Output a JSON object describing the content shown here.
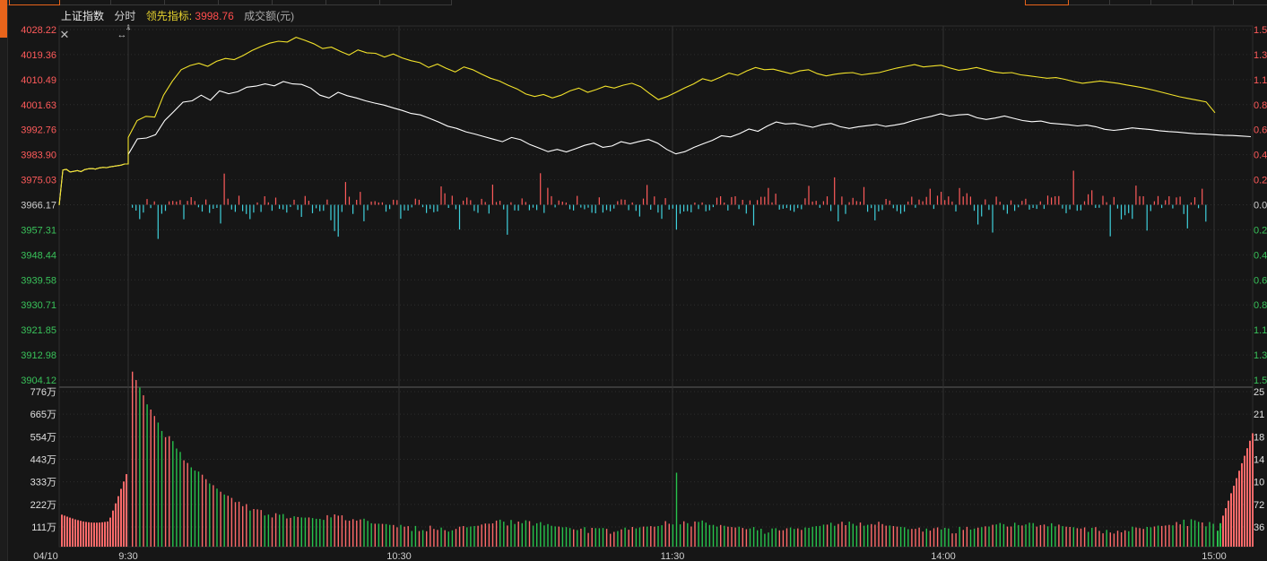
{
  "header": {
    "index_name": "上证指数",
    "mode": "分时",
    "lead_label": "领先指标:",
    "lead_value": "3998.76",
    "amount_label": "成交额(元)"
  },
  "colors": {
    "background": "#161616",
    "grid": "#2e2e2e",
    "index_line": "#ffffff",
    "lead_line": "#f2e22a",
    "up": "#ff5a5a",
    "down": "#3fd0dc",
    "vol_up": "#ff6a6a",
    "vol_down": "#27c24c",
    "price_up_label": "#ff5b5b",
    "price_down_label": "#39c25a",
    "neutral_label": "#cfcfcf"
  },
  "icons": {
    "close": "close-icon",
    "resize": "horizontal-resize-icon",
    "cursor": "vertical-cursor-icon"
  },
  "chart_data": {
    "type": "line",
    "x_ticks": [
      "04/10",
      "9:30",
      "10:30",
      "11:30",
      "14:00",
      "15:00"
    ],
    "price_axis": {
      "ticks": [
        "4028.22",
        "4019.36",
        "4010.49",
        "4001.63",
        "3992.76",
        "3983.90",
        "3975.03",
        "3966.17",
        "3957.31",
        "3948.44",
        "3939.58",
        "3930.71",
        "3921.85",
        "3912.98",
        "3904.12"
      ],
      "base": 3966.17,
      "ylim": [
        3904.12,
        4028.22
      ]
    },
    "pct_axis": {
      "ticks": [
        "1.5",
        "1.3",
        "1.1",
        "0.8",
        "0.6",
        "0.4",
        "0.2",
        "0.0",
        "0.2",
        "0.4",
        "0.6",
        "0.8",
        "1.1",
        "1.3",
        "1.5"
      ]
    },
    "volume_axis": {
      "left_ticks": [
        "776万",
        "665万",
        "554万",
        "443万",
        "333万",
        "222万",
        "111万"
      ],
      "right_ticks": [
        "25",
        "21",
        "18",
        "14",
        "10",
        "72",
        "36"
      ],
      "ylim": [
        0,
        776
      ]
    },
    "series": [
      {
        "name": "上证指数",
        "values": [
          3966.0,
          3978.5,
          3978.7,
          3977.8,
          3978.0,
          3978.3,
          3977.9,
          3978.6,
          3978.9,
          3979.0,
          3978.8,
          3979.2,
          3979.4,
          3979.3,
          3979.6,
          3979.8,
          3980.0,
          3980.2,
          3980.6,
          3980.6,
          3984.0,
          3989.5,
          3989.8,
          3991.0,
          3996.0,
          3999.2,
          4002.5,
          4003.0,
          4005.0,
          4003.2,
          4006.5,
          4005.5,
          4006.2,
          4007.8,
          4008.2,
          4009.0,
          4008.3,
          4009.8,
          4009.0,
          4008.8,
          4007.5,
          4005.0,
          4004.0,
          4006.0,
          4004.8,
          4004.0,
          4003.0,
          4002.2,
          4001.5,
          4000.5,
          3999.6,
          3998.5,
          3998.0,
          3996.8,
          3995.5,
          3994.0,
          3993.2,
          3992.0,
          3991.2,
          3990.3,
          3989.4,
          3988.5,
          3990.0,
          3989.2,
          3987.5,
          3986.3,
          3985.0,
          3985.8,
          3984.9,
          3986.0,
          3987.2,
          3988.0,
          3986.5,
          3987.0,
          3988.5,
          3987.8,
          3988.6,
          3989.3,
          3988.0,
          3985.8,
          3984.2,
          3985.0,
          3986.5,
          3987.8,
          3989.0,
          3990.6,
          3990.2,
          3991.4,
          3993.0,
          3992.2,
          3994.0,
          3995.5,
          3994.8,
          3995.0,
          3994.3,
          3993.6,
          3994.5,
          3995.0,
          3993.8,
          3993.2,
          3993.8,
          3994.2,
          3994.6,
          3993.9,
          3994.4,
          3995.0,
          3996.0,
          3996.8,
          3997.5,
          3998.4,
          3997.6,
          3998.0,
          3998.2,
          3997.0,
          3996.4,
          3996.9,
          3997.6,
          3996.8,
          3996.0,
          3995.6,
          3995.8,
          3995.1,
          3994.8,
          3994.5,
          3994.1,
          3994.4,
          3993.8,
          3992.9,
          3992.5,
          3992.9,
          3993.4,
          3993.1,
          3992.8,
          3992.4,
          3992.1,
          3991.9,
          3991.6,
          3991.3,
          3991.2,
          3991.0,
          3990.8,
          3990.7,
          3990.5,
          3990.3
        ],
        "x_start_min": 0,
        "x_end_min": 280
      },
      {
        "name": "领先指标",
        "values": [
          3966.0,
          3978.5,
          3978.7,
          3977.8,
          3978.0,
          3978.3,
          3977.9,
          3978.6,
          3978.9,
          3979.0,
          3978.8,
          3979.2,
          3979.4,
          3979.3,
          3979.6,
          3979.8,
          3980.0,
          3980.2,
          3980.6,
          3980.6,
          3990.0,
          3996.0,
          3997.5,
          3997.2,
          4005.0,
          4010.0,
          4014.0,
          4015.5,
          4016.3,
          4015.2,
          4017.0,
          4018.0,
          4017.6,
          4019.0,
          4020.8,
          4022.2,
          4023.4,
          4024.1,
          4023.8,
          4025.5,
          4024.4,
          4023.2,
          4021.5,
          4022.0,
          4020.5,
          4019.2,
          4021.0,
          4020.0,
          4019.8,
          4018.5,
          4019.6,
          4018.2,
          4017.2,
          4016.5,
          4014.8,
          4016.0,
          4014.5,
          4013.2,
          4015.0,
          4014.0,
          4012.4,
          4011.0,
          4010.0,
          4008.5,
          4007.2,
          4005.4,
          4004.5,
          4005.2,
          4004.0,
          4005.0,
          4006.5,
          4007.5,
          4006.0,
          4007.0,
          4008.2,
          4007.5,
          4008.5,
          4009.2,
          4008.0,
          4005.6,
          4003.4,
          4004.5,
          4006.0,
          4007.6,
          4009.0,
          4010.8,
          4010.0,
          4011.3,
          4012.8,
          4012.0,
          4013.6,
          4014.8,
          4014.0,
          4014.2,
          4013.4,
          4012.6,
          4013.6,
          4014.0,
          4012.6,
          4011.8,
          4012.4,
          4012.8,
          4013.0,
          4012.2,
          4012.6,
          4013.0,
          4013.8,
          4014.6,
          4015.2,
          4015.8,
          4015.0,
          4015.3,
          4015.6,
          4014.6,
          4013.8,
          4014.2,
          4014.8,
          4014.0,
          4013.2,
          4012.8,
          4013.0,
          4012.2,
          4011.8,
          4011.4,
          4011.0,
          4011.2,
          4010.6,
          4009.8,
          4009.2,
          4009.6,
          4010.0,
          4009.6,
          4009.2,
          4008.6,
          4008.1,
          4007.5,
          4006.8,
          4006.0,
          4005.2,
          4004.4,
          4003.8,
          4003.2,
          4002.6,
          3998.76
        ],
        "x_start_min": 0,
        "x_end_min": 270
      }
    ],
    "volume_note": "成交额(元)"
  }
}
